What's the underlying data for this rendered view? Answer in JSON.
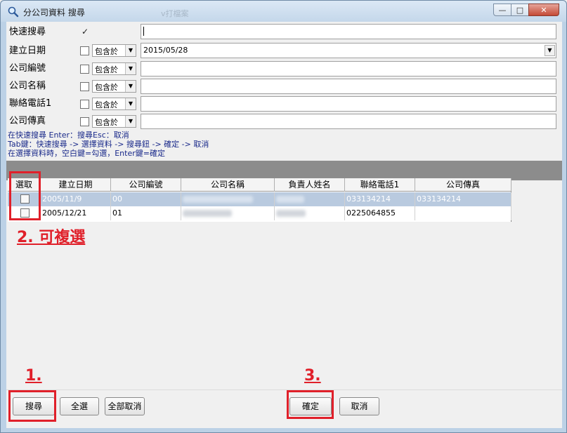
{
  "window": {
    "title": "分公司資料 搜尋",
    "ghost_text": "ⅴ打檔案",
    "min_glyph": "—",
    "max_glyph": "□",
    "close_glyph": "✕"
  },
  "form": {
    "quick_search": {
      "label": "快速搜尋",
      "checked": true,
      "value": ""
    },
    "rows": [
      {
        "label": "建立日期",
        "operator": "包含於",
        "value": "2015/05/28"
      },
      {
        "label": "公司編號",
        "operator": "包含於",
        "value": ""
      },
      {
        "label": "公司名稱",
        "operator": "包含於",
        "value": ""
      },
      {
        "label": "聯絡電話1",
        "operator": "包含於",
        "value": ""
      },
      {
        "label": "公司傳真",
        "operator": "包含於",
        "value": ""
      }
    ],
    "check_glyph": "✓",
    "arrow_glyph": "▼"
  },
  "hints": [
    "在快速搜尋 Enter：搜尋Esc：取消",
    "Tab鍵：快速搜尋 -> 選擇資料 -> 搜尋鈕 -> 確定 -> 取消",
    "在選擇資料時，空白鍵=勾選，Enter鍵=確定"
  ],
  "grid": {
    "columns": [
      "選取",
      "建立日期",
      "公司編號",
      "公司名稱",
      "負責人姓名",
      "聯絡電話1",
      "公司傳真"
    ],
    "rows": [
      {
        "date": "2005/11/9",
        "code": "00",
        "phone": "033134214",
        "fax": "033134214",
        "selected": true
      },
      {
        "date": "2005/12/21",
        "code": "01",
        "phone": "0225064855",
        "fax": "",
        "selected": false
      }
    ]
  },
  "buttons": {
    "search": "搜尋",
    "select_all": "全選",
    "deselect_all": "全部取消",
    "ok": "確定",
    "cancel": "取消"
  },
  "annotations": {
    "a1": "1.",
    "a2": "2. 可複選",
    "a3": "3."
  },
  "colors": {
    "highlight": "#e0202a",
    "selected_row": "#b9cadf"
  }
}
